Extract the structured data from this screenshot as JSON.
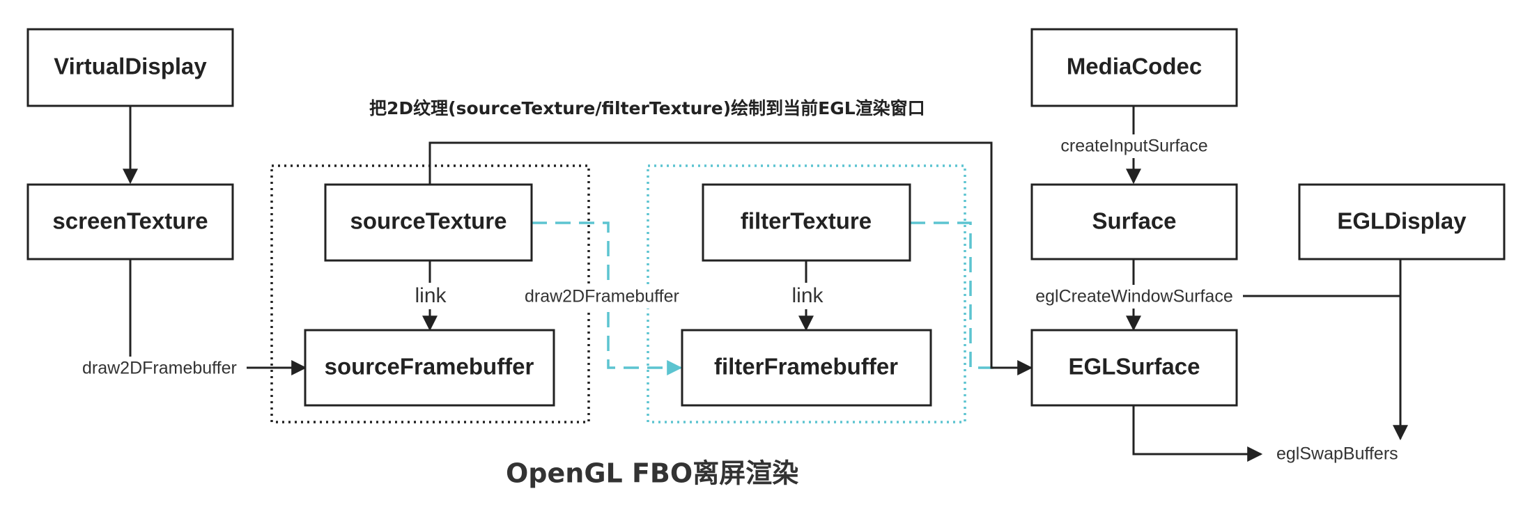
{
  "colors": {
    "stroke": "#222222",
    "dashed_cyan": "#5cc4d0",
    "dotted_black": "#222222"
  },
  "nodes": {
    "virtual_display": "VirtualDisplay",
    "screen_texture": "screenTexture",
    "source_texture": "sourceTexture",
    "source_framebuffer": "sourceFramebuffer",
    "filter_texture": "filterTexture",
    "filter_framebuffer": "filterFramebuffer",
    "media_codec": "MediaCodec",
    "surface": "Surface",
    "egl_display": "EGLDisplay",
    "egl_surface": "EGLSurface"
  },
  "edge_labels": {
    "draw_2d_framebuffer_left": "draw2DFramebuffer",
    "link_source": "link",
    "draw_2d_framebuffer_mid": "draw2DFramebuffer",
    "link_filter": "link",
    "create_input_surface": "createInputSurface",
    "egl_create_window_surface": "eglCreateWindowSurface",
    "egl_swap_buffers": "eglSwapBuffers"
  },
  "annotations": {
    "top_note": "把2D纹理(sourceTexture/filterTexture)绘制到当前EGL渲染窗口",
    "footer": "OpenGL FBO离屏渲染"
  }
}
